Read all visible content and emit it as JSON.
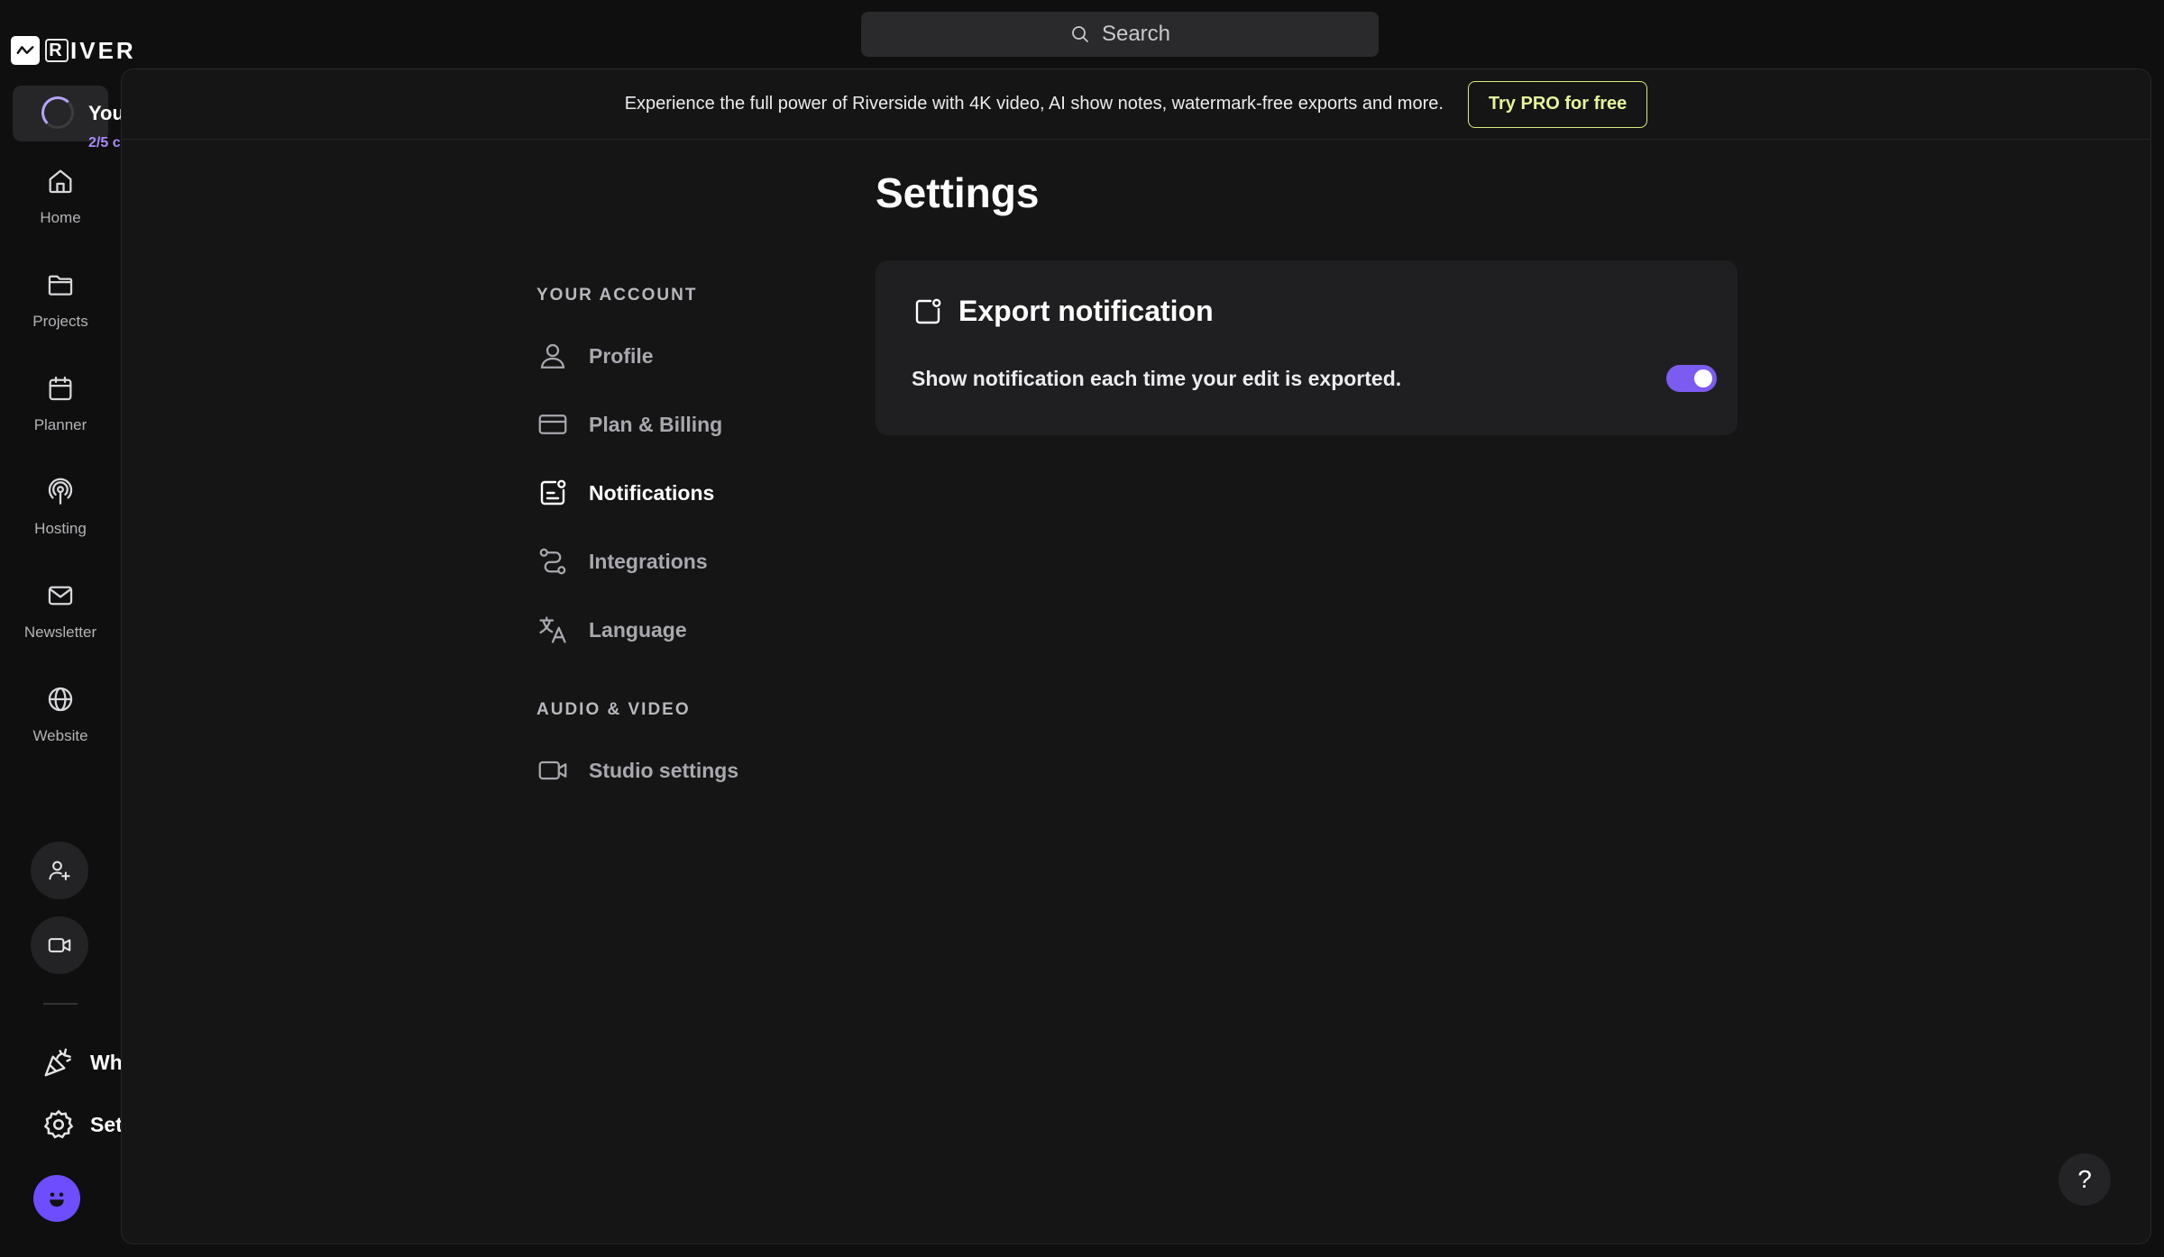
{
  "brand": {
    "name": "RIVER"
  },
  "workspace": {
    "name": "You",
    "usage": "2/5 c"
  },
  "nav": {
    "items": [
      {
        "label": "Home",
        "icon": "home-icon"
      },
      {
        "label": "Projects",
        "icon": "folder-icon"
      },
      {
        "label": "Planner",
        "icon": "calendar-icon"
      },
      {
        "label": "Hosting",
        "icon": "podcast-icon"
      },
      {
        "label": "Newsletter",
        "icon": "mail-icon"
      },
      {
        "label": "Website",
        "icon": "globe-icon"
      }
    ]
  },
  "rail_bottom": {
    "whats_new": "Wh",
    "settings": "Set"
  },
  "search": {
    "placeholder": "Search"
  },
  "promo": {
    "text": "Experience the full power of Riverside with 4K video, AI show notes, watermark-free exports and more.",
    "button": "Try PRO for free"
  },
  "page": {
    "title": "Settings"
  },
  "settings_nav": {
    "account_heading": "YOUR ACCOUNT",
    "account_items": [
      {
        "label": "Profile",
        "icon": "user-icon"
      },
      {
        "label": "Plan & Billing",
        "icon": "credit-card-icon"
      },
      {
        "label": "Notifications",
        "icon": "notification-icon",
        "active": true
      },
      {
        "label": "Integrations",
        "icon": "integrations-icon"
      },
      {
        "label": "Language",
        "icon": "translate-icon"
      }
    ],
    "av_heading": "AUDIO & VIDEO",
    "av_items": [
      {
        "label": "Studio settings",
        "icon": "video-camera-icon"
      }
    ]
  },
  "export_card": {
    "title": "Export notification",
    "description": "Show notification each time your edit is exported.",
    "enabled": true
  },
  "help": {
    "label": "?"
  },
  "colors": {
    "accent": "#7c5cf0",
    "promo_border": "#d8ec7a",
    "background": "#0f0f0f",
    "panel": "#151516",
    "card": "#1f1f21"
  }
}
